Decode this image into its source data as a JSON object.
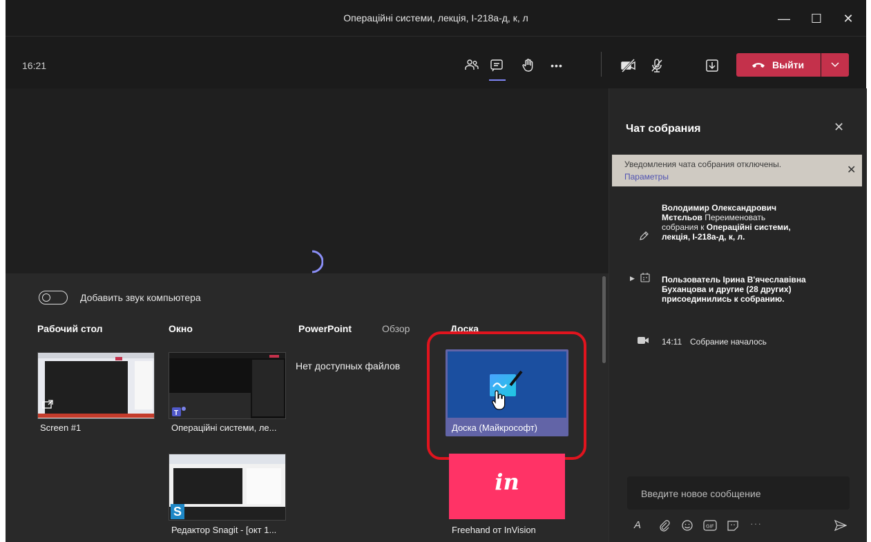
{
  "window": {
    "title": "Операційні системи, лекція, І-218а-д, к, л",
    "minimize": "—",
    "maximize": "☐",
    "close": "✕"
  },
  "toolbar": {
    "time": "16:21",
    "more": "•••",
    "leave_label": "Выйти",
    "leave_color": "#c4314b"
  },
  "share": {
    "audio_toggle_label": "Добавить звук компьютера",
    "sections": {
      "desktop": "Рабочий стол",
      "window": "Окно",
      "powerpoint": "PowerPoint",
      "browse": "Обзор",
      "whiteboard": "Доска"
    },
    "no_files": "Нет доступных файлов",
    "desktop_items": [
      {
        "label": "Screen #1"
      }
    ],
    "window_items": [
      {
        "label": "Операційні системи, ле..."
      },
      {
        "label": "Редактор Snagit - [окт 1..."
      }
    ],
    "whiteboard_items": [
      {
        "label": "Доска (Майкрософт)"
      },
      {
        "label": "Freehand от InVision",
        "logo": "in"
      }
    ]
  },
  "chat": {
    "title": "Чат собрания",
    "banner": {
      "text": "Уведомления чата собрания отключены.",
      "link": "Параметры"
    },
    "rename": {
      "name": "Володимир Олександрович Мєтєльов",
      "action": "Переименовать собрания к",
      "meeting": "Операційні системи, лекція, І-218а-д, к, л."
    },
    "join": {
      "prefix": "Пользователь",
      "name": "Ірина В'ячеславівна Буханцова",
      "middle": "и",
      "others": "другие (28 других)",
      "suffix": "присоединились к собранию."
    },
    "started": {
      "time": "14:11",
      "text": "Собрание началось"
    },
    "input_placeholder": "Введите новое сообщение"
  },
  "colors": {
    "accent": "#7f85f5",
    "highlight_ring": "#e0141e",
    "whiteboard_tile": "#1b4fa0",
    "invision_tile": "#ff3366"
  }
}
